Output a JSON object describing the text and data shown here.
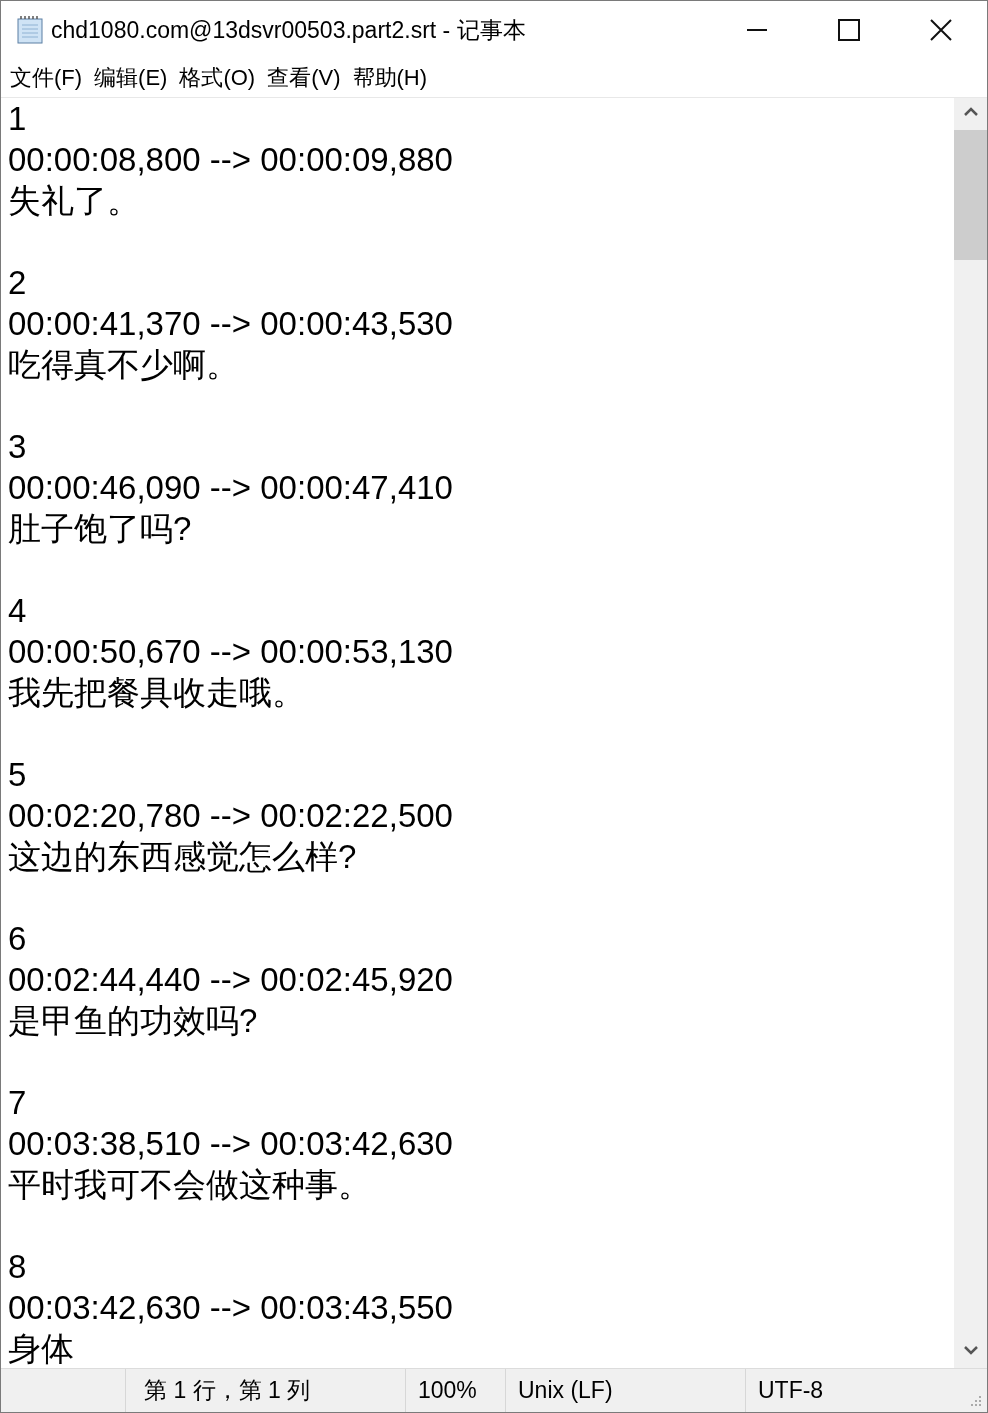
{
  "window": {
    "title": "chd1080.com@13dsvr00503.part2.srt - 记事本"
  },
  "menu": [
    "文件(F)",
    "编辑(E)",
    "格式(O)",
    "查看(V)",
    "帮助(H)"
  ],
  "entries": [
    {
      "index": "1",
      "time": "00:00:08,800 --> 00:00:09,880",
      "text": "失礼了。"
    },
    {
      "index": "2",
      "time": "00:00:41,370 --> 00:00:43,530",
      "text": "吃得真不少啊。"
    },
    {
      "index": "3",
      "time": "00:00:46,090 --> 00:00:47,410",
      "text": "肚子饱了吗?"
    },
    {
      "index": "4",
      "time": "00:00:50,670 --> 00:00:53,130",
      "text": "我先把餐具收走哦。"
    },
    {
      "index": "5",
      "time": "00:02:20,780 --> 00:02:22,500",
      "text": "这边的东西感觉怎么样?"
    },
    {
      "index": "6",
      "time": "00:02:44,440 --> 00:02:45,920",
      "text": "是甲鱼的功效吗?"
    },
    {
      "index": "7",
      "time": "00:03:38,510 --> 00:03:42,630",
      "text": "平时我可不会做这种事。"
    },
    {
      "index": "8",
      "time": "00:03:42,630 --> 00:03:43,550",
      "text": "身体"
    }
  ],
  "status_bar": {
    "position": "第 1 行，第 1 列",
    "zoom": "100%",
    "line_ending": "Unix (LF)",
    "encoding": "UTF-8"
  }
}
